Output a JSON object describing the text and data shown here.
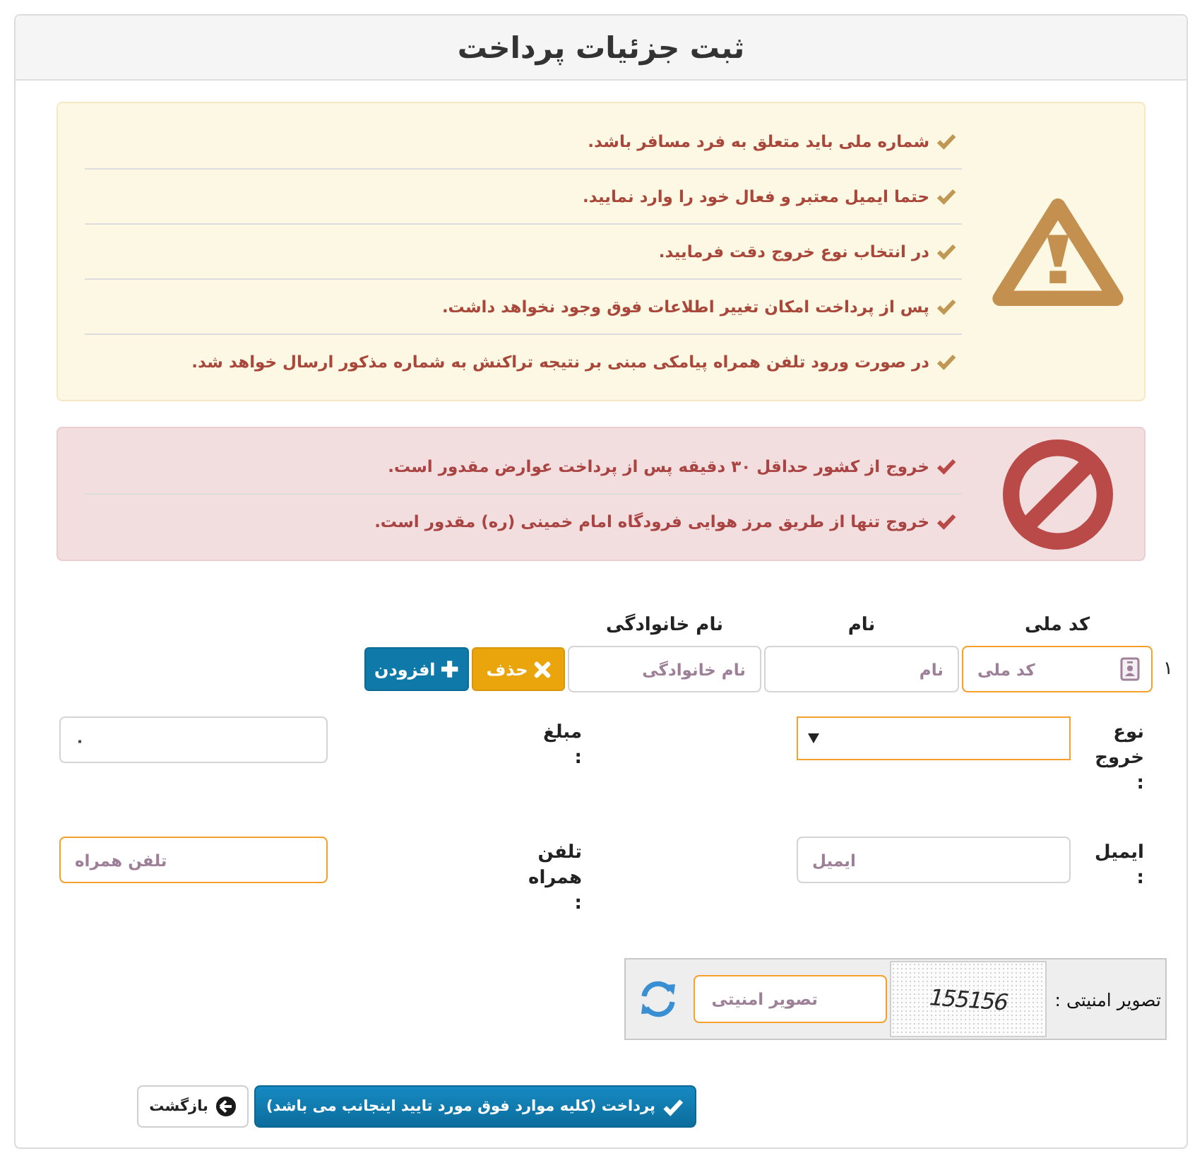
{
  "page": {
    "title": "ثبت جزئیات پرداخت"
  },
  "alerts": [
    {
      "kind": "warning",
      "items": [
        "شماره ملی باید متعلق به فرد مسافر باشد.",
        "حتما ایمیل معتبر و فعال خود را وارد نمایید.",
        "در انتخاب نوع خروج دقت فرمایید.",
        "پس از پرداخت امکان تغییر اطلاعات فوق وجود نخواهد داشت.",
        "در صورت ورود تلفن همراه پیامکی مبنی بر نتیجه تراکنش به شماره مذکور ارسال خواهد شد."
      ]
    },
    {
      "kind": "danger",
      "items": [
        "خروج از کشور حداقل ۳۰ دقیقه پس از پرداخت عوارض مقدور است.",
        "خروج تنها از طریق مرز هوایی فرودگاه امام خمینی (ره) مقدور است."
      ]
    }
  ],
  "passengers": {
    "columns": [
      "کد ملی",
      "نام",
      "نام خانوادگی"
    ],
    "rows": [
      {
        "number": "۱",
        "fields": [
          {
            "kind": "national_id",
            "placeholder": "کد ملی",
            "highlighted": true
          },
          {
            "kind": "text",
            "placeholder": "نام",
            "highlighted": false
          },
          {
            "kind": "text",
            "placeholder": "نام خانوادگی",
            "highlighted": false
          }
        ],
        "buttons": [
          {
            "kind": "delete",
            "label": "حذف"
          },
          {
            "kind": "add",
            "label": "افزودن"
          }
        ]
      }
    ]
  },
  "form": {
    "fields": [
      {
        "kind": "select",
        "label": "نوع خروج :",
        "highlighted": true
      },
      {
        "kind": "number",
        "label": "مبلغ :",
        "value": "۰",
        "highlighted": false
      },
      {
        "kind": "email",
        "label": "ایمیل :",
        "placeholder": "ایمیل",
        "highlighted": false
      },
      {
        "kind": "tel",
        "label": "تلفن همراه :",
        "placeholder": "تلفن همراه",
        "highlighted": true
      }
    ]
  },
  "captcha": {
    "label": "تصویر امنیتی :",
    "code": "155156",
    "placeholder": "تصویر امنیتی",
    "highlighted": true
  },
  "actions": [
    {
      "kind": "submit",
      "label": "پرداخت (کلیه موارد فوق مورد تایید اینجانب می باشد)"
    },
    {
      "kind": "back",
      "label": "بازگشت"
    }
  ]
}
